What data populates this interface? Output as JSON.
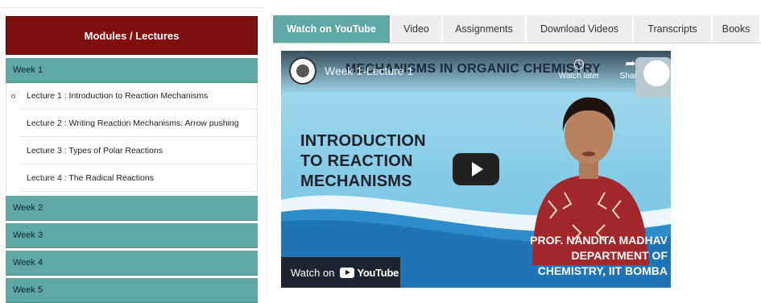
{
  "sidebar": {
    "header": "Modules / Lectures",
    "weeks": [
      "Week 1",
      "Week 2",
      "Week 3",
      "Week 4",
      "Week 5"
    ],
    "lectures": [
      "Lecture 1 : Introduction to Reaction Mechanisms",
      "Lecture 2 : Writing Reaction Mechanisms: Arrow pushing",
      "Lecture 3 : Types of Polar Reactions",
      "Lecture 4 : The Radical Reactions"
    ]
  },
  "tabs": [
    "Watch on YouTube",
    "Video",
    "Assignments",
    "Download Videos",
    "Transcripts",
    "Books"
  ],
  "video": {
    "course_title": "MECHANISMS IN ORGANIC CHEMISTRY",
    "overlay_title": "Week 1-Lecture 1",
    "watch_later": "Watch later",
    "share": "Share",
    "heading_lines": [
      "INTRODUCTION",
      "TO REACTION",
      "MECHANISMS"
    ],
    "prof_lines": [
      "PROF. NANDITA MADHAV",
      "DEPARTMENT OF",
      "CHEMISTRY, IIT BOMBA"
    ],
    "watch_on": "Watch on",
    "youtube_label": "YouTube"
  },
  "colors": {
    "header_bg": "#7f1010",
    "week_bg": "#5fa8a3",
    "tab_active_bg": "#5fa8a3",
    "tab_bg": "#eeeeee"
  }
}
